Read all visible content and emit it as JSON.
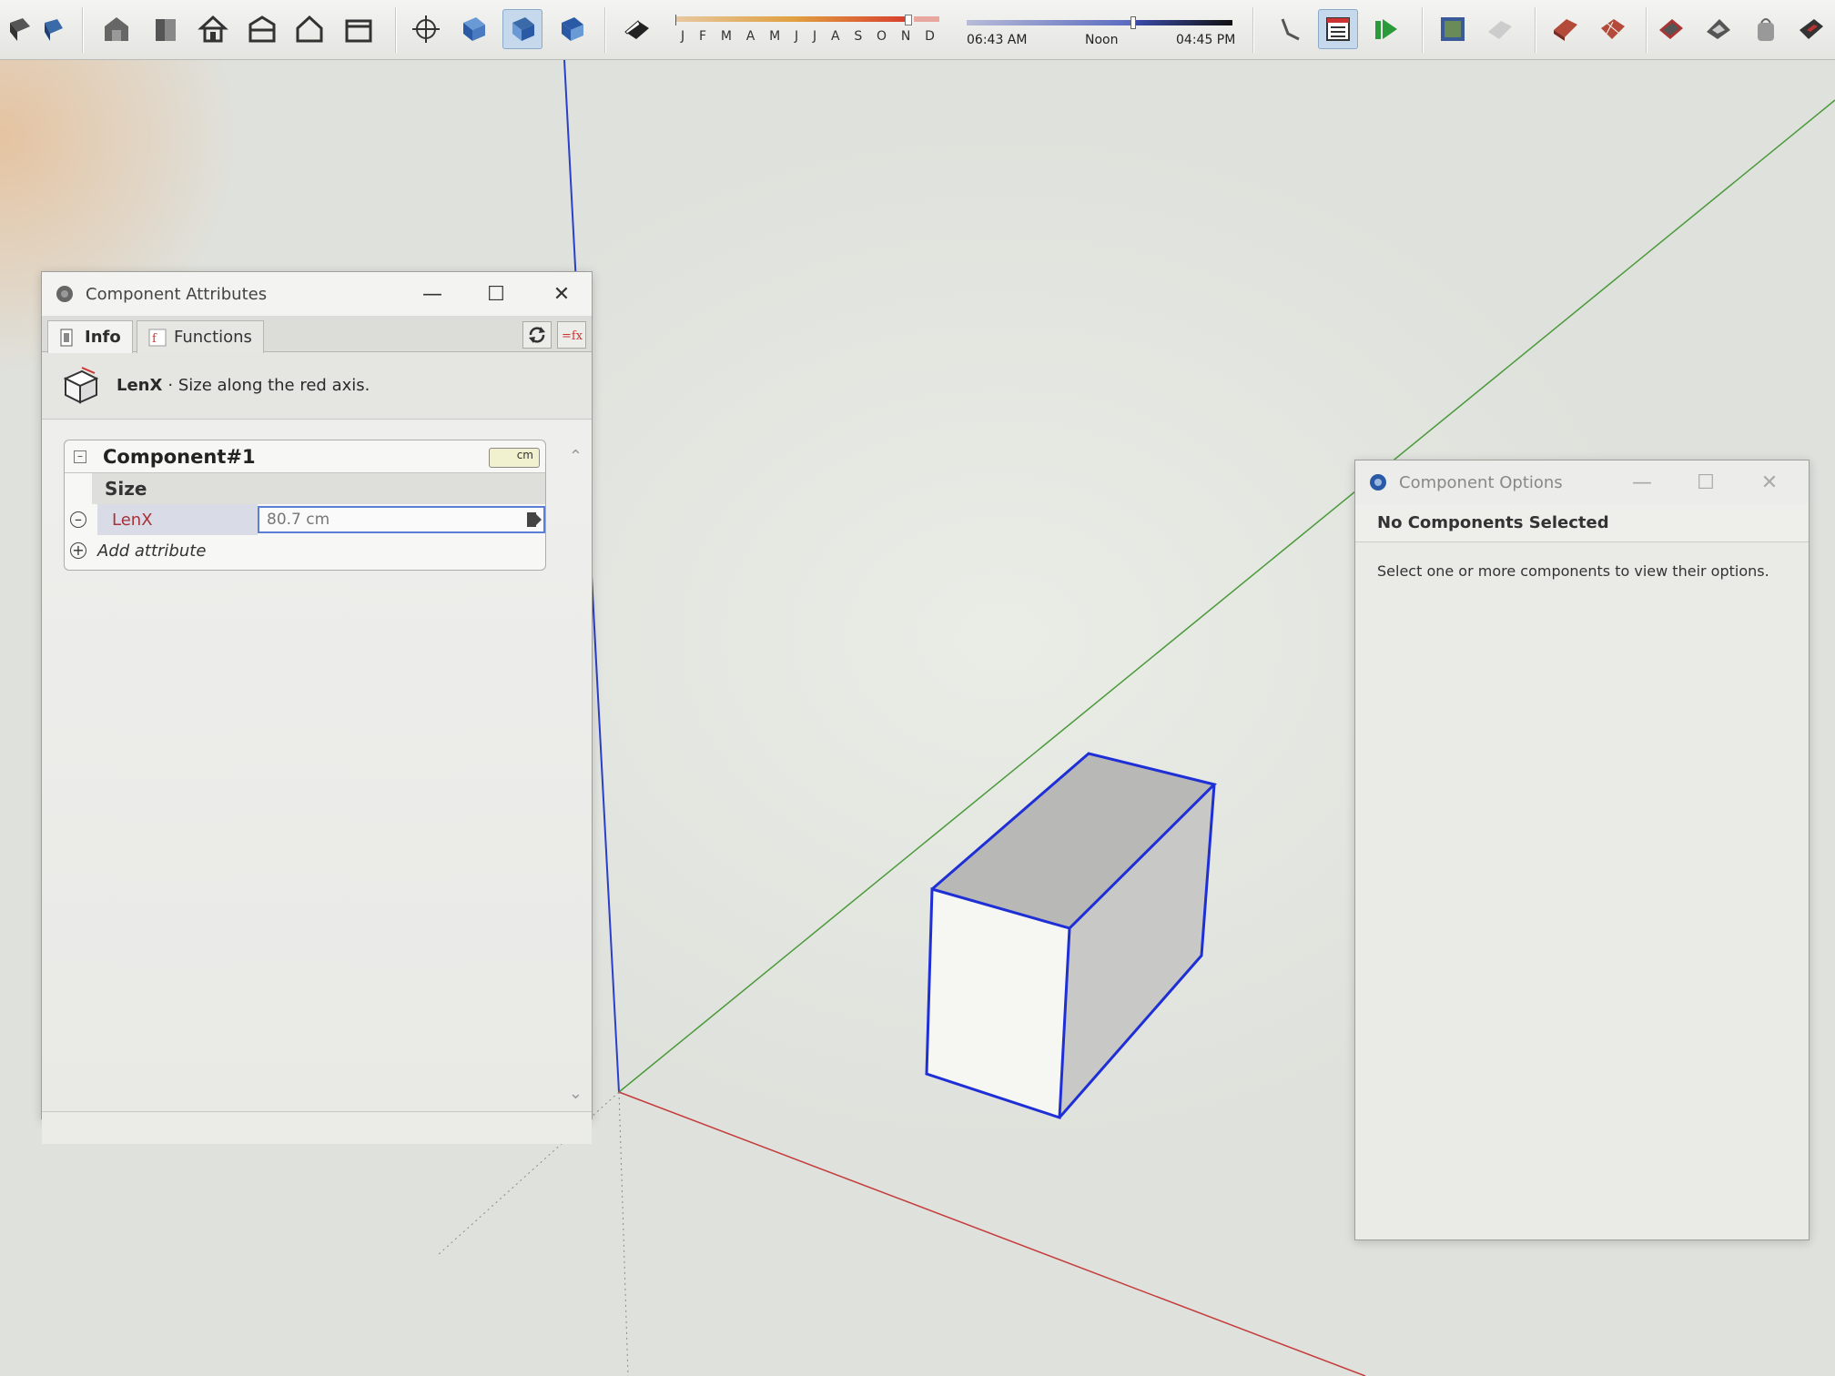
{
  "toolbar": {
    "months": [
      "J",
      "F",
      "M",
      "A",
      "M",
      "J",
      "J",
      "A",
      "S",
      "O",
      "N",
      "D"
    ],
    "time_start": "06:43 AM",
    "time_mid": "Noon",
    "time_end": "04:45 PM",
    "icons": [
      "component-icon",
      "component-blue-icon",
      "house-icon",
      "building-icon",
      "home-icon",
      "house-front-icon",
      "house-outline-icon",
      "warehouse-icon",
      "orbit-icon",
      "iso-view-icon",
      "top-view-icon",
      "front-view-icon",
      "shadow-icon",
      "footprint-icon",
      "text-list-icon",
      "play-forward-icon",
      "map-icon",
      "terrain-icon",
      "roof-icon",
      "grid-icon",
      "layer-icon",
      "sandbox-icon",
      "bag-icon",
      "extension-icon"
    ]
  },
  "component_attributes": {
    "title": "Component Attributes",
    "tabs": [
      {
        "label": "Info",
        "active": true
      },
      {
        "label": "Functions",
        "active": false
      }
    ],
    "info": {
      "name": "LenX",
      "description": "· Size along the red axis."
    },
    "component": {
      "name": "Component#1",
      "unit": "cm",
      "group_label": "Size",
      "attribute_name": "LenX",
      "attribute_value": "80.7 cm",
      "add_label": "Add attribute"
    }
  },
  "component_options": {
    "title": "Component Options",
    "heading": "No Components Selected",
    "message": "Select one or more components to view their options."
  },
  "colors": {
    "red_axis": "#c43c3c",
    "green_axis": "#4a9a3a",
    "blue_axis": "#2b3fc8",
    "selection": "#1f2fd6",
    "attr_name": "#a8323a"
  }
}
